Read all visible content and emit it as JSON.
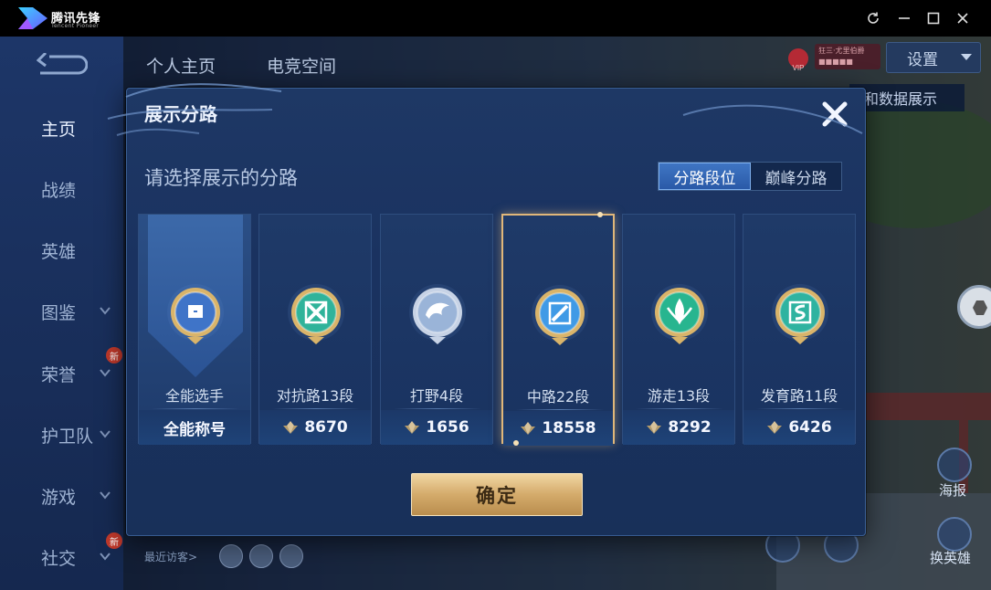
{
  "app": {
    "logo_text": "腾讯先锋",
    "logo_sub": "Tencent Pioneer",
    "window_controls": [
      "refresh-icon",
      "minimize-icon",
      "maximize-icon",
      "close-icon"
    ]
  },
  "game_bg": {
    "top_tabs": [
      "个人主页",
      "电竞空间"
    ],
    "settings_label": "设置",
    "data_banner": "和数据展示",
    "vip_label": "VIP",
    "vip_tag_text": "狂三·尤里伯爵 ■■■■■",
    "sidebar": [
      {
        "label": "主页",
        "active": true,
        "chevron": false,
        "badge": false
      },
      {
        "label": "战绩",
        "active": false,
        "chevron": false,
        "badge": false
      },
      {
        "label": "英雄",
        "active": false,
        "chevron": false,
        "badge": false
      },
      {
        "label": "图鉴",
        "active": false,
        "chevron": true,
        "badge": false
      },
      {
        "label": "荣誉",
        "active": false,
        "chevron": true,
        "badge": true
      },
      {
        "label": "护卫队",
        "active": false,
        "chevron": true,
        "badge": false
      },
      {
        "label": "游戏",
        "active": false,
        "chevron": true,
        "badge": false
      },
      {
        "label": "社交",
        "active": false,
        "chevron": true,
        "badge": true
      }
    ],
    "badge_text": "新",
    "visitors_label": "最近访客>",
    "right_buttons": [
      "海报",
      "换英雄"
    ]
  },
  "modal": {
    "title": "展示分路",
    "subtitle": "请选择展示的分路",
    "toggle": [
      {
        "label": "分路段位",
        "active": true
      },
      {
        "label": "巅峰分路",
        "active": false
      }
    ],
    "cards": [
      {
        "label": "全能选手",
        "bottom": "全能称号",
        "score": null,
        "emblem": "all-round",
        "color": "#3f74c8",
        "selected": false
      },
      {
        "label": "对抗路13段",
        "bottom": null,
        "score": "8670",
        "emblem": "clash-lane",
        "color": "#2fb39a",
        "selected": false
      },
      {
        "label": "打野4段",
        "bottom": null,
        "score": "1656",
        "emblem": "jungle",
        "color": "#9ab4d8",
        "selected": false
      },
      {
        "label": "中路22段",
        "bottom": null,
        "score": "18558",
        "emblem": "mid-lane",
        "color": "#3f9ae6",
        "selected": true
      },
      {
        "label": "游走13段",
        "bottom": null,
        "score": "8292",
        "emblem": "roam",
        "color": "#27b58f",
        "selected": false
      },
      {
        "label": "发育路11段",
        "bottom": null,
        "score": "6426",
        "emblem": "farm-lane",
        "color": "#2fb3a0",
        "selected": false
      }
    ],
    "confirm_label": "确定"
  },
  "colors": {
    "accent_gold": "#d4ab6b",
    "toggle_active": "#3f75c4",
    "modal_bg": "#1a3260"
  }
}
